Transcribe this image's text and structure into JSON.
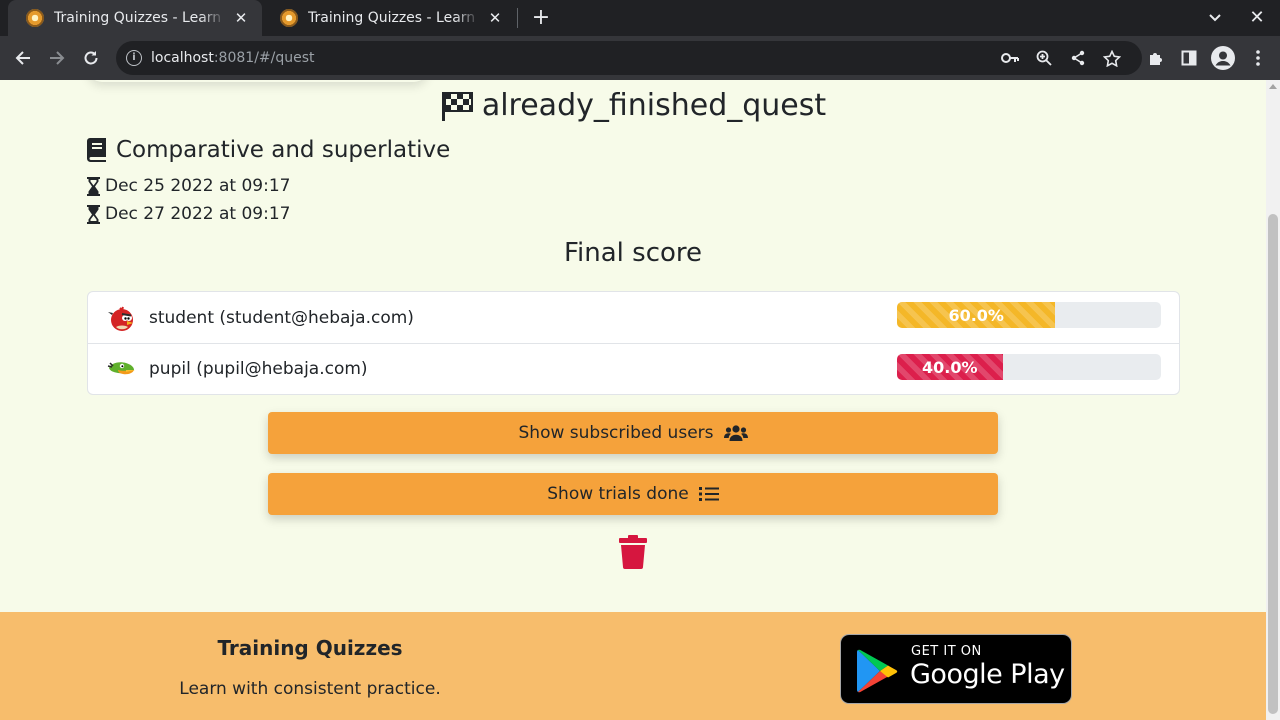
{
  "browser": {
    "tabs": [
      {
        "title": "Training Quizzes - Learn with consistent practice",
        "active": true
      },
      {
        "title": "Training Quizzes - Learn with consistent practice",
        "active": false
      }
    ],
    "url_host": "localhost",
    "url_rest": ":8081/#/quest",
    "icons": {
      "tab_close": "✕",
      "new_tab": "+",
      "tab_search": "chevron-down-icon",
      "window_close": "✕"
    }
  },
  "quest": {
    "title": "already_finished_quest",
    "lesson": "Comparative and superlative",
    "start_date": "Dec 25 2022 at 09:17",
    "end_date": "Dec 27 2022 at 09:17"
  },
  "scores": {
    "heading": "Final score",
    "rows": [
      {
        "name": "student (student@hebaja.com)",
        "label": "60.0%",
        "value": 0.6,
        "color": "#f4b728",
        "avatar": "red-bird-avatar"
      },
      {
        "name": "pupil (pupil@hebaja.com)",
        "label": "40.0%",
        "value": 0.4,
        "color": "#dc1f4c",
        "avatar": "green-bird-avatar"
      }
    ]
  },
  "actions": {
    "subscribed_label": "Show subscribed users",
    "trials_label": "Show trials done",
    "accent": "#f5a23b",
    "danger": "#d6163f"
  },
  "footer": {
    "brand": "Training Quizzes",
    "tagline": "Learn with consistent practice.",
    "badge_top": "GET IT ON",
    "badge_bottom": "Google Play",
    "background": "#f7bd6c"
  }
}
